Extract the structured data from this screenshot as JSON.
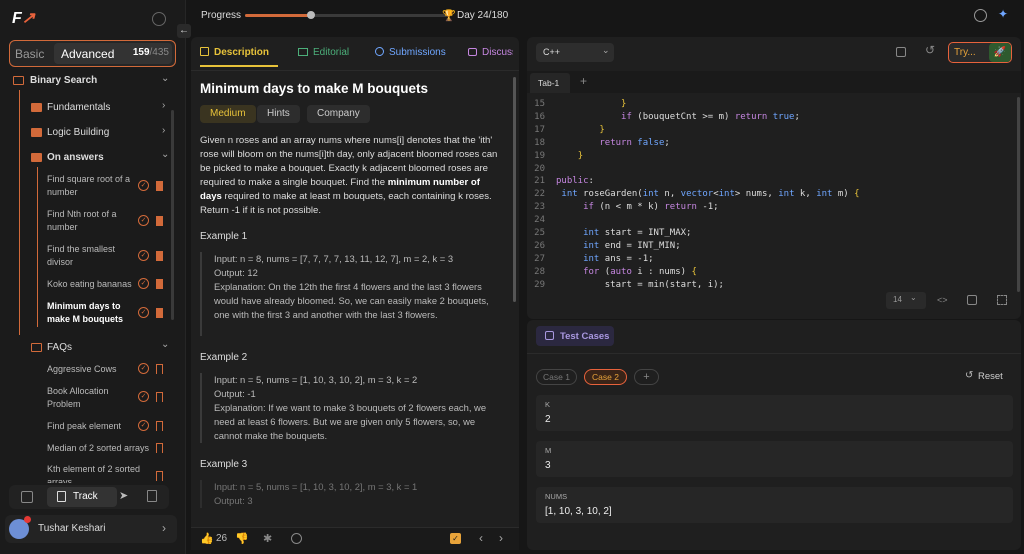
{
  "sidebar": {
    "toggle": {
      "basic": "Basic",
      "advanced": "Advanced",
      "count": "159",
      "total": "/435"
    },
    "section": "Binary Search",
    "groups": [
      "Fundamentals",
      "Logic Building",
      "On answers"
    ],
    "items": [
      "Find square root of a number",
      "Find Nth root of a number",
      "Find the smallest divisor",
      "Koko eating bananas",
      "Minimum days to make M bouquets"
    ],
    "faqs_label": "FAQs",
    "faqs": [
      "Aggressive Cows",
      "Book Allocation Problem",
      "Find peak element",
      "Median of 2 sorted arrays",
      "Kth element of 2 sorted arrays"
    ],
    "track_label": "Track",
    "user": "Tushar Keshari"
  },
  "topbar": {
    "progress_label": "Progress",
    "progress_value": 0.32,
    "day": "Day 24/180"
  },
  "tabs": [
    "Description",
    "Editorial",
    "Submissions",
    "Discuss"
  ],
  "problem": {
    "title": "Minimum days to make M bouquets",
    "difficulty": "Medium",
    "hints": "Hints",
    "company": "Company",
    "p1": "Given n roses and an array nums where nums[i] denotes that the 'ith' rose will bloom on the nums[i]th day, only adjacent bloomed roses can be picked to make a bouquet. Exactly k adjacent bloomed roses are required to make a single bouquet. Find the ",
    "p1b": "minimum number of days",
    "p1c": " required to make at least m bouquets, each containing k roses. Return -1 if it is not possible.",
    "ex1_title": "Example 1",
    "ex1_input": "Input: n = 8, nums = [7, 7, 7, 7, 13, 11, 12, 7], m = 2, k = 3",
    "ex1_output": "Output: 12",
    "ex1_expl": "Explanation: On the 12th the first 4 flowers and the last 3 flowers would have already bloomed. So, we can easily make 2 bouquets, one with the first 3 and another with the last 3 flowers.",
    "ex2_title": "Example 2",
    "ex2_input": "Input: n = 5, nums = [1, 10, 3, 10, 2], m = 3, k = 2",
    "ex2_output": "Output: -1",
    "ex2_expl": "Explanation: If we want to make 3 bouquets of 2 flowers each, we need at least 6 flowers. But we are given only 5 flowers, so, we cannot make the bouquets.",
    "ex3_title": "Example 3",
    "ex3_input": "Input: n = 5, nums = [1, 10, 3, 10, 2], m = 3, k = 1",
    "ex3_output": "Output: 3"
  },
  "likes": "26",
  "editor": {
    "lang": "C++",
    "try": "Try...",
    "tab": "Tab-1",
    "font_size": "14",
    "lines": [
      {
        "n": "15",
        "t": "            }"
      },
      {
        "n": "16",
        "t": "            if (bouquetCnt >= m) return true;"
      },
      {
        "n": "17",
        "t": "        }"
      },
      {
        "n": "18",
        "t": "        return false;"
      },
      {
        "n": "19",
        "t": "    }"
      },
      {
        "n": "20",
        "t": ""
      },
      {
        "n": "21",
        "t": "public:"
      },
      {
        "n": "22",
        "t": " int roseGarden(int n, vector<int> nums, int k, int m) {"
      },
      {
        "n": "23",
        "t": "     if (n < m * k) return -1;"
      },
      {
        "n": "24",
        "t": ""
      },
      {
        "n": "25",
        "t": "     int start = INT_MAX;"
      },
      {
        "n": "26",
        "t": "     int end = INT_MIN;"
      },
      {
        "n": "27",
        "t": "     int ans = -1;"
      },
      {
        "n": "28",
        "t": "     for (auto i : nums) {"
      },
      {
        "n": "29",
        "t": "         start = min(start, i);"
      }
    ]
  },
  "tests": {
    "title": "Test Cases",
    "case1": "Case 1",
    "case2": "Case 2",
    "reset": "Reset",
    "fields": [
      {
        "label": "K",
        "value": "2"
      },
      {
        "label": "M",
        "value": "3"
      },
      {
        "label": "NUMS",
        "value": "[1, 10, 3, 10, 2]"
      }
    ]
  }
}
